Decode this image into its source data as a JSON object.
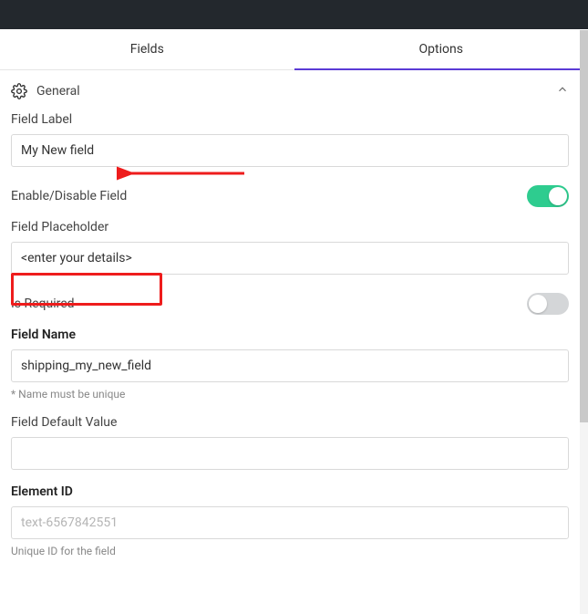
{
  "tabs": {
    "fields": "Fields",
    "options": "Options"
  },
  "section": {
    "general": "General"
  },
  "labels": {
    "field_label": "Field Label",
    "enable_disable": "Enable/Disable Field",
    "field_placeholder": "Field Placeholder",
    "is_required": "Is Required",
    "field_name": "Field Name",
    "field_default_value": "Field Default Value",
    "element_id": "Element ID"
  },
  "values": {
    "field_label": "My New field",
    "field_placeholder": "<enter your details>",
    "field_name": "shipping_my_new_field",
    "field_default_value": "",
    "element_id_placeholder": "text-6567842551"
  },
  "helpers": {
    "name_unique": "* Name must be unique",
    "element_id": "Unique ID for the field"
  }
}
